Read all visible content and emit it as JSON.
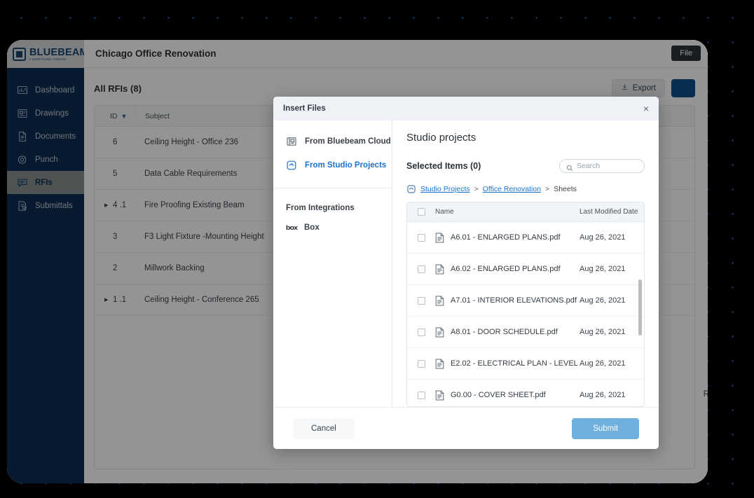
{
  "app": {
    "logo_word": "BLUEBEAM",
    "logo_tagline": "A NEMETSCHEK COMPANY",
    "project_title": "Chicago Office Renovation",
    "file_chip": "File"
  },
  "sidebar": {
    "items": [
      {
        "label": "Dashboard",
        "icon": "dashboard-icon",
        "active": false
      },
      {
        "label": "Drawings",
        "icon": "drawings-icon",
        "active": false
      },
      {
        "label": "Documents",
        "icon": "documents-icon",
        "active": false
      },
      {
        "label": "Punch",
        "icon": "punch-icon",
        "active": false
      },
      {
        "label": "RFIs",
        "icon": "rfis-icon",
        "active": true
      },
      {
        "label": "Submittals",
        "icon": "submittals-icon",
        "active": false
      }
    ]
  },
  "rfi_page": {
    "title": "All RFIs (8)",
    "export_label": "Export",
    "columns": {
      "id": "ID",
      "subject": "Subject"
    },
    "rows": [
      {
        "id": "6",
        "subject": "Ceiling Height - Office 236",
        "expandable": false
      },
      {
        "id": "5",
        "subject": "Data Cable Requirements",
        "expandable": false
      },
      {
        "id": "4 .1",
        "subject": "Fire Proofing Existing Beam",
        "expandable": true
      },
      {
        "id": "3",
        "subject": "F3 Light Fixture -Mounting Height",
        "expandable": false
      },
      {
        "id": "2",
        "subject": "Millwork Backing",
        "expandable": false
      },
      {
        "id": "1 .1",
        "subject": "Ceiling Height - Conference 265",
        "expandable": true
      }
    ],
    "right_cut_label": "R"
  },
  "modal": {
    "title": "Insert Files",
    "close_label": "×",
    "sources": [
      {
        "label": "From Bluebeam Cloud",
        "icon": "cloud-panel-icon",
        "active": false
      },
      {
        "label": "From Studio Projects",
        "icon": "studio-projects-icon",
        "active": true
      }
    ],
    "integrations_heading": "From Integrations",
    "integrations": [
      {
        "label": "Box",
        "logo": "box"
      }
    ],
    "panel_title": "Studio projects",
    "selected_items_label": "Selected Items (0)",
    "search": {
      "placeholder": "Search",
      "value": ""
    },
    "breadcrumb": [
      {
        "label": "Studio Projects",
        "link": true
      },
      {
        "label": ">",
        "link": false
      },
      {
        "label": "Office Renovation",
        "link": true
      },
      {
        "label": ">",
        "link": false
      },
      {
        "label": "Sheets",
        "link": false
      }
    ],
    "table": {
      "columns": {
        "name": "Name",
        "date": "Last Modified Date"
      },
      "rows": [
        {
          "name": "A6.01 - ENLARGED PLANS.pdf",
          "date": "Aug 26, 2021",
          "checked": false
        },
        {
          "name": "A6.02 - ENLARGED PLANS.pdf",
          "date": "Aug 26, 2021",
          "checked": false
        },
        {
          "name": "A7.01 - INTERIOR ELEVATIONS.pdf",
          "date": "Aug 26, 2021",
          "checked": false
        },
        {
          "name": "A8.01 - DOOR SCHEDULE.pdf",
          "date": "Aug 26, 2021",
          "checked": false
        },
        {
          "name": "E2.02 - ELECTRICAL PLAN - LEVEL",
          "date": "Aug 26, 2021",
          "checked": false
        },
        {
          "name": "G0.00 - COVER SHEET.pdf",
          "date": "Aug 26, 2021",
          "checked": false
        }
      ]
    },
    "cancel_label": "Cancel",
    "submit_label": "Submit"
  },
  "colors": {
    "sidebar_bg": "#0d2d52",
    "accent_blue": "#1a73d1",
    "submit_blue": "#6fb0df",
    "bg_dot": "#17305c"
  }
}
